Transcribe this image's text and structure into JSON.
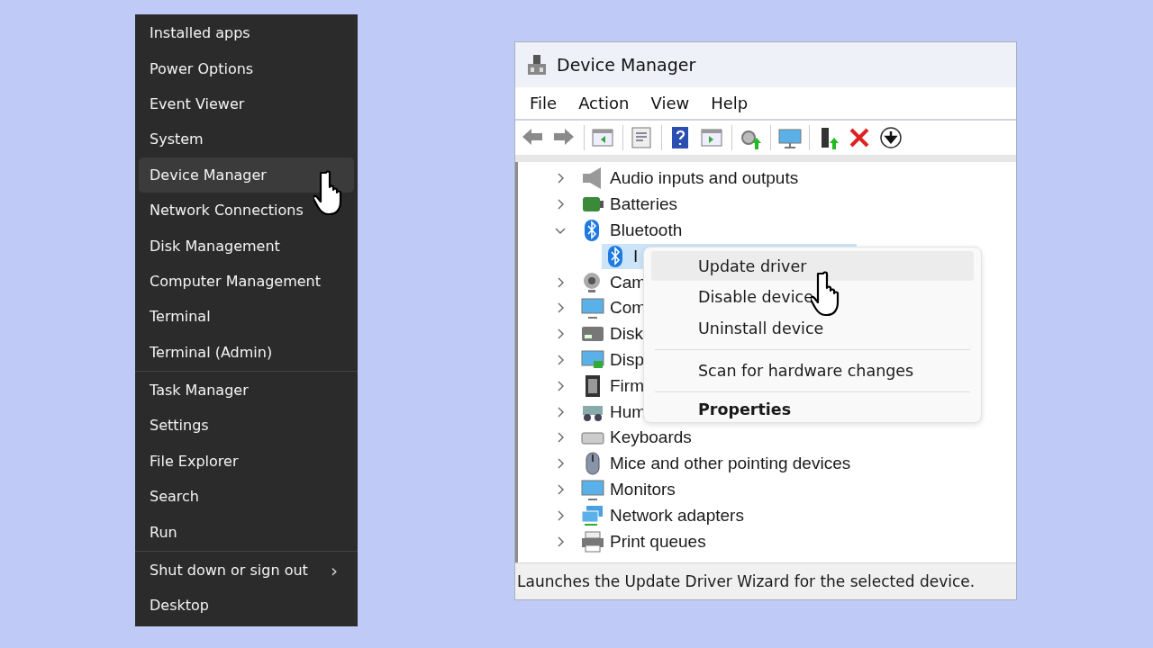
{
  "start_menu": {
    "groups": [
      [
        {
          "label": "Installed apps",
          "selected": false
        },
        {
          "label": "Power Options",
          "selected": false
        },
        {
          "label": "Event Viewer",
          "selected": false
        },
        {
          "label": "System",
          "selected": false
        },
        {
          "label": "Device Manager",
          "selected": true
        },
        {
          "label": "Network Connections",
          "selected": false
        },
        {
          "label": "Disk Management",
          "selected": false
        },
        {
          "label": "Computer Management",
          "selected": false
        },
        {
          "label": "Terminal",
          "selected": false
        },
        {
          "label": "Terminal (Admin)",
          "selected": false
        }
      ],
      [
        {
          "label": "Task Manager",
          "selected": false
        },
        {
          "label": "Settings",
          "selected": false
        },
        {
          "label": "File Explorer",
          "selected": false
        },
        {
          "label": "Search",
          "selected": false
        },
        {
          "label": "Run",
          "selected": false
        }
      ],
      [
        {
          "label": "Shut down or sign out",
          "selected": false,
          "submenu_arrow": "›"
        },
        {
          "label": "Desktop",
          "selected": false
        }
      ]
    ]
  },
  "device_manager": {
    "window": {
      "title": "Device Manager"
    },
    "menu_bar": [
      "File",
      "Action",
      "View",
      "Help"
    ],
    "tree": [
      {
        "label": "Audio inputs and outputs",
        "expanded": false
      },
      {
        "label": "Batteries",
        "expanded": false
      },
      {
        "label": "Bluetooth",
        "expanded": true,
        "children": [
          {
            "label": "I",
            "selected": true
          }
        ]
      },
      {
        "label": "Cam",
        "expanded": false
      },
      {
        "label": "Com",
        "expanded": false
      },
      {
        "label": "Disk",
        "expanded": false
      },
      {
        "label": "Disp",
        "expanded": false
      },
      {
        "label": "Firm",
        "expanded": false
      },
      {
        "label": "Hum",
        "expanded": false
      },
      {
        "label": "Keyboards",
        "expanded": false
      },
      {
        "label": "Mice and other pointing devices",
        "expanded": false
      },
      {
        "label": "Monitors",
        "expanded": false
      },
      {
        "label": "Network adapters",
        "expanded": false
      },
      {
        "label": "Print queues",
        "expanded": false
      }
    ],
    "context_menu": {
      "groups": [
        [
          {
            "label": "Update driver",
            "selected": true,
            "default": false
          },
          {
            "label": "Disable device",
            "selected": false,
            "default": false
          },
          {
            "label": "Uninstall device",
            "selected": false,
            "default": false
          }
        ],
        [
          {
            "label": "Scan for hardware changes",
            "selected": false,
            "default": false
          }
        ],
        [
          {
            "label": "Properties",
            "selected": false,
            "default": true
          }
        ]
      ]
    },
    "status_bar": "Launches the Update Driver Wizard for the selected device."
  }
}
